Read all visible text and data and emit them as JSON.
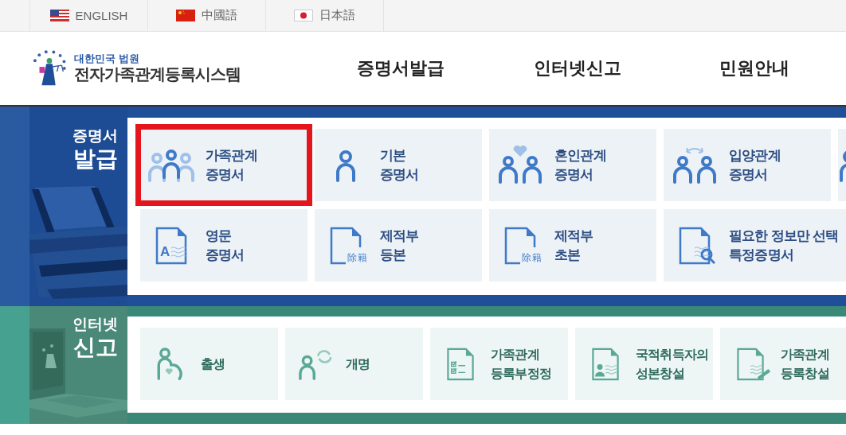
{
  "language_bar": [
    {
      "label": "ENGLISH"
    },
    {
      "label": "中國語"
    },
    {
      "label": "日本語"
    }
  ],
  "logo": {
    "org": "대한민국 법원",
    "title": "전자가족관계등록시스템"
  },
  "nav": [
    "증명서발급",
    "인터넷신고",
    "민원안내"
  ],
  "sections": [
    {
      "kind": "certificate",
      "title_small": "증명서",
      "title_big": "발급",
      "rows": [
        [
          {
            "lines": [
              "가족관계",
              "증명서"
            ],
            "highlighted": true
          },
          {
            "lines": [
              "기본",
              "증명서"
            ],
            "highlighted": false
          },
          {
            "lines": [
              "혼인관계",
              "증명서"
            ],
            "highlighted": false
          },
          {
            "lines": [
              "입양관계",
              "증명서"
            ],
            "highlighted": false
          },
          {
            "highlighted": false
          }
        ],
        [
          {
            "icon_text": "A",
            "lines": [
              "영문",
              "증명서"
            ],
            "highlighted": false
          },
          {
            "icon_text": "除籍",
            "lines": [
              "제적부",
              "등본"
            ],
            "highlighted": false
          },
          {
            "icon_text": "除籍",
            "lines": [
              "제적부",
              "초본"
            ],
            "highlighted": false
          },
          {
            "lines": [
              "필요한 정보만 선택",
              "특정증명서"
            ],
            "highlighted": false
          }
        ]
      ]
    },
    {
      "kind": "report",
      "title_small": "인터넷",
      "title_big": "신고",
      "rows": [
        [
          {
            "lines": [
              "출생"
            ],
            "highlighted": false
          },
          {
            "lines": [
              "개명"
            ],
            "highlighted": false
          },
          {
            "lines": [
              "가족관계",
              "등록부정정"
            ],
            "highlighted": false
          },
          {
            "lines": [
              "국적취득자의",
              "성본창설"
            ],
            "highlighted": false
          },
          {
            "lines": [
              "가족관계",
              "등록창설"
            ],
            "highlighted": false
          }
        ]
      ]
    }
  ]
}
